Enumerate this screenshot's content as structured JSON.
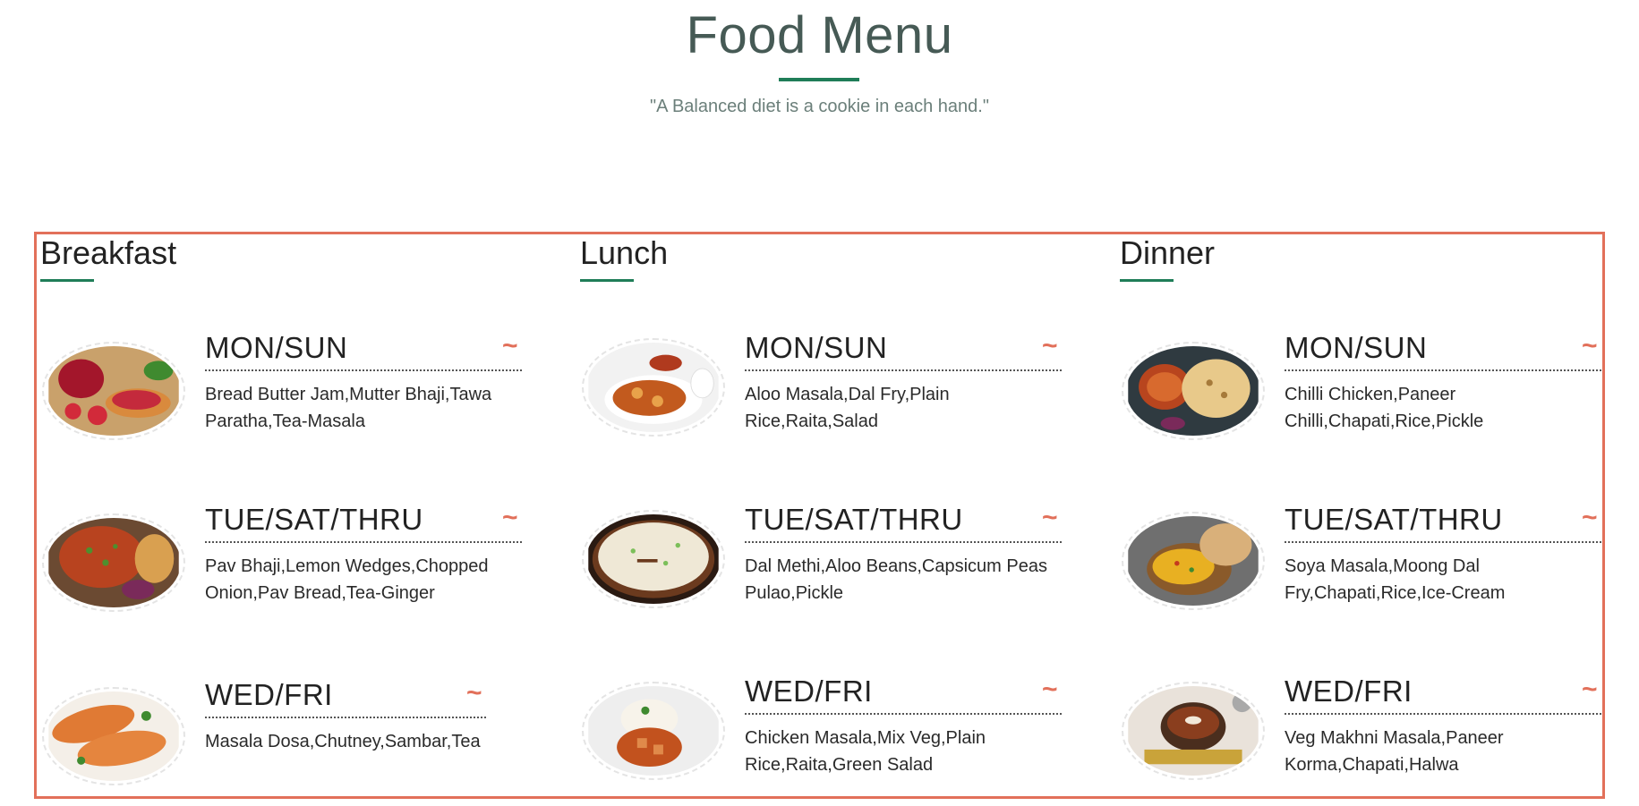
{
  "header": {
    "title": "Food Menu",
    "quote": "\"A Balanced diet is a cookie in each hand.\""
  },
  "colors": {
    "accent": "#e2705a",
    "green": "#1f7d58",
    "title": "#465a55"
  },
  "breakfast": {
    "title": "Breakfast",
    "items": [
      {
        "day": "MON/SUN",
        "desc": "Bread Butter Jam,Mutter Bhaji,Tawa Paratha,Tea-Masala",
        "icon": "jam-bread-image"
      },
      {
        "day": "TUE/SAT/THRU",
        "desc": "Pav Bhaji,Lemon Wedges,Chopped Onion,Pav Bread,Tea-Ginger",
        "icon": "pav-bhaji-image"
      },
      {
        "day": "WED/FRI",
        "desc": "Masala Dosa,Chutney,Sambar,Tea",
        "icon": "dosa-image"
      }
    ]
  },
  "lunch": {
    "title": "Lunch",
    "items": [
      {
        "day": "MON/SUN",
        "desc": "Aloo Masala,Dal Fry,Plain Rice,Raita,Salad",
        "icon": "aloo-masala-image"
      },
      {
        "day": "TUE/SAT/THRU",
        "desc": "Dal Methi,Aloo Beans,Capsicum Peas Pulao,Pickle",
        "icon": "pulao-image"
      },
      {
        "day": "WED/FRI",
        "desc": "Chicken Masala,Mix Veg,Plain Rice,Raita,Green Salad",
        "icon": "chicken-rice-image"
      }
    ]
  },
  "dinner": {
    "title": "Dinner",
    "items": [
      {
        "day": "MON/SUN",
        "desc": "Chilli Chicken,Paneer Chilli,Chapati,Rice,Pickle",
        "icon": "paneer-chapati-image"
      },
      {
        "day": "TUE/SAT/THRU",
        "desc": "Soya Masala,Moong Dal Fry,Chapati,Rice,Ice-Cream",
        "icon": "moong-dal-image"
      },
      {
        "day": "WED/FRI",
        "desc": "Veg Makhni Masala,Paneer Korma,Chapati,Halwa",
        "icon": "dal-makhni-image"
      }
    ]
  },
  "tilde_symbol": "~"
}
